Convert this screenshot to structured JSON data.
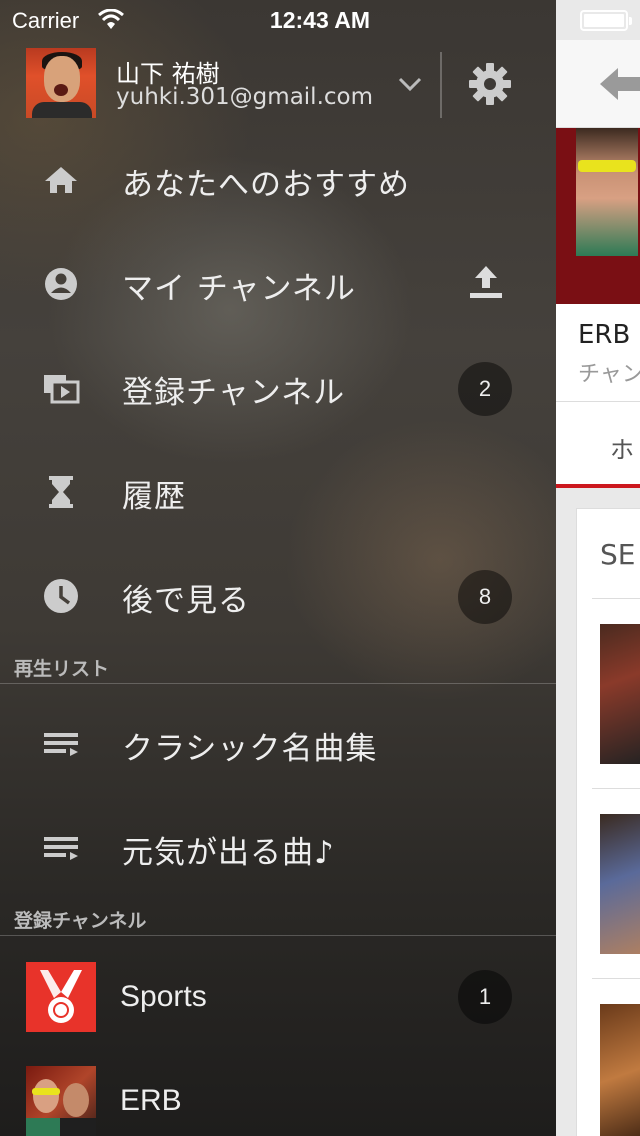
{
  "status_bar": {
    "carrier": "Carrier",
    "time": "12:43 AM"
  },
  "account": {
    "name": "山下 祐樹",
    "email": "yuhki.301@gmail.com"
  },
  "menu": [
    {
      "label": "あなたへのおすすめ",
      "icon": "home-icon"
    },
    {
      "label": "マイ チャンネル",
      "icon": "account-circle-icon",
      "action_icon": "upload-icon"
    },
    {
      "label": "登録チャンネル",
      "icon": "subscriptions-icon",
      "badge": "2"
    },
    {
      "label": "履歴",
      "icon": "hourglass-icon"
    },
    {
      "label": "後で見る",
      "icon": "clock-icon",
      "badge": "8"
    }
  ],
  "playlists_section": {
    "title": "再生リスト",
    "items": [
      {
        "label": "クラシック名曲集",
        "icon": "playlist-icon"
      },
      {
        "label": "元気が出る曲♪",
        "icon": "playlist-icon"
      }
    ]
  },
  "subscriptions_section": {
    "title": "登録チャンネル",
    "items": [
      {
        "label": "Sports",
        "badge": "1",
        "icon": "sports-medal-thumbnail"
      },
      {
        "label": "ERB",
        "icon": "erb-channel-thumbnail"
      }
    ]
  },
  "background_page": {
    "channel_name": "ERB",
    "channel_sub": "チャン",
    "tab_label": "ホ",
    "card_title": "SE"
  },
  "colors": {
    "accent_red": "#cc181e",
    "badge_bg": "#2a2a2a",
    "sports_red": "#e8332a"
  }
}
